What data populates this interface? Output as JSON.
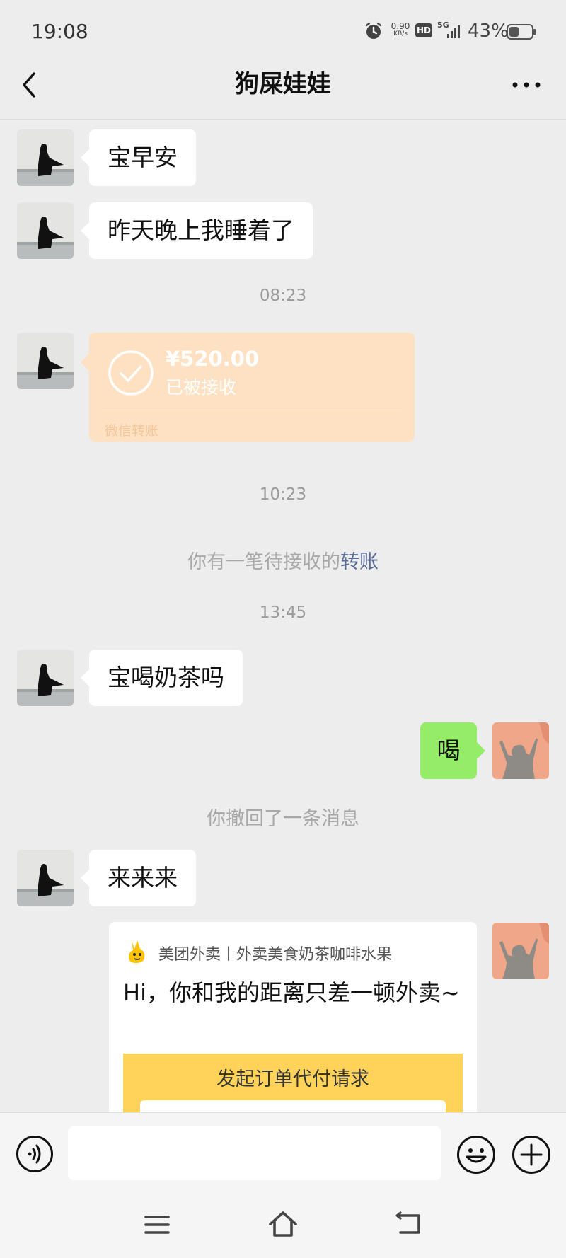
{
  "status_bar": {
    "time": "19:08",
    "net_speed_value": "0.90",
    "net_speed_unit": "KB/s",
    "hd_label": "HD",
    "network": "5G",
    "battery": "43%",
    "battery_level": 0.43
  },
  "header": {
    "title": "狗屎娃娃",
    "back_icon": "chevron-left-icon",
    "more_icon": "more-dots-icon"
  },
  "messages": [
    {
      "text": "宝早安"
    },
    {
      "text": "昨天晚上我睡着了"
    },
    {
      "timestamp": "08:23"
    },
    {
      "transfer": {
        "amount": "¥520.00",
        "status": "已被接收",
        "footer": "微信转账"
      }
    },
    {
      "timestamp": "10:23"
    },
    {
      "system": {
        "prefix": "你有一笔待接收的",
        "link": "转账"
      }
    },
    {
      "timestamp": "13:45"
    },
    {
      "text": "宝喝奶茶吗"
    },
    {
      "text": "喝"
    },
    {
      "system_plain": "你撤回了一条消息"
    },
    {
      "text": "来来来"
    },
    {
      "card": {
        "source": "美团外卖丨外卖美食奶茶咖啡水果",
        "title": "Hi，你和我的距离只差一顿外卖~",
        "banner": "发起订单代付请求"
      }
    }
  ],
  "input_bar": {
    "placeholder": "",
    "voice_icon": "voice-icon",
    "emoji_icon": "emoji-icon",
    "plus_icon": "plus-icon"
  },
  "colors": {
    "background": "#ededed",
    "bubble_other": "#ffffff",
    "bubble_me": "#95ec69",
    "transfer_card": "#fde1c2",
    "link": "#576b95",
    "banner": "#ffd25a"
  }
}
